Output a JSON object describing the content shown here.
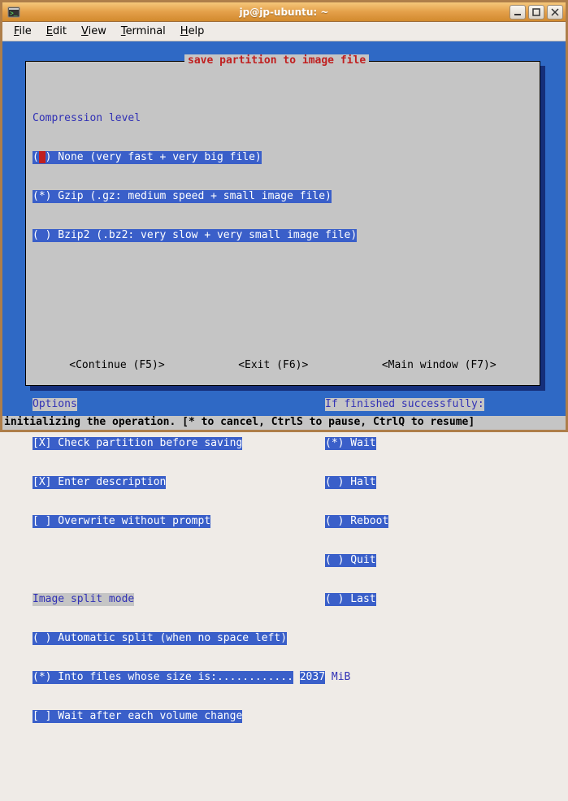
{
  "window": {
    "title": "jp@jp-ubuntu: ~"
  },
  "menu": {
    "file": "File",
    "edit": "Edit",
    "view": "View",
    "terminal": "Terminal",
    "help": "Help"
  },
  "panel": {
    "title": "save partition to image file"
  },
  "compression": {
    "heading": "Compression level",
    "none": "( ) None (very fast + very big file)",
    "gzip": "(*) Gzip (.gz: medium speed + small image file)",
    "bzip2": "( ) Bzip2 (.bz2: very slow + very small image file)"
  },
  "options": {
    "heading": "Options",
    "check": "[X] Check partition before saving",
    "descr": "[X] Enter description",
    "over": "[ ] Overwrite without prompt"
  },
  "finished": {
    "heading": "If finished successfully:",
    "wait": "(*) Wait",
    "halt": "( ) Halt",
    "reboot": "( ) Reboot",
    "quit": "( ) Quit",
    "last": "( ) Last"
  },
  "split": {
    "heading": "Image split mode",
    "auto": "( ) Automatic split (when no space left)",
    "size_prefix": "(*) Into files whose size is:............",
    "size_value": "2037",
    "size_unit": "MiB",
    "wait": "[ ] Wait after each volume change"
  },
  "actions": {
    "continue": "<Continue (F5)>",
    "exit": "<Exit (F6)>",
    "mainwin": "<Main window (F7)>"
  },
  "status": "initializing the operation. [* to cancel, CtrlS to pause, CtrlQ to resume]"
}
